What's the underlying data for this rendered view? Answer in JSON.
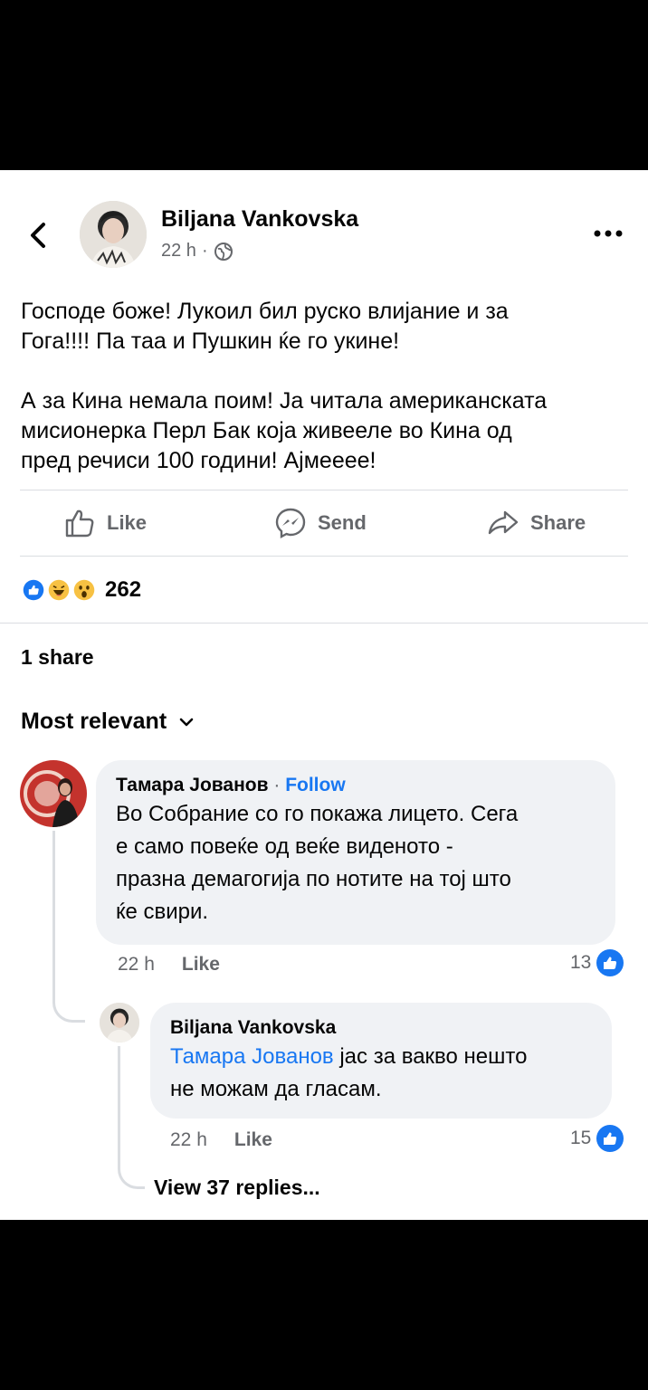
{
  "post": {
    "author": "Biljana Vankovska",
    "time": "22 h",
    "separator": "·",
    "paragraphs": [
      "Господе боже! Лукоил бил руско влијание и за\nГога!!!! Па таа и Пушкин ќе го укине!",
      "А за Кина немала поим! Ја читала американската\nмисионерка Перл Бак која живееле во Кина од\nпред речиси 100 години! Ајмееее!"
    ]
  },
  "actions": {
    "like": "Like",
    "send": "Send",
    "share": "Share"
  },
  "reactions": {
    "count": "262",
    "icons": [
      "like-reaction-icon",
      "haha-reaction-icon",
      "wow-reaction-icon"
    ]
  },
  "shares": "1 share",
  "sort_label": "Most relevant",
  "comments": [
    {
      "name": "Тамара Јованов",
      "follow": "Follow",
      "separator": " · ",
      "text": "Во Собрание со го покажа лицето. Сега\nе само повеќе од веќе виденото -\nпразна демагогија по нотите на тој што\nќе свири.",
      "time": "22 h",
      "like": "Like",
      "reactions": "13"
    }
  ],
  "reply": {
    "name": "Biljana Vankovska",
    "mention": "Тамара Јованов",
    "text_line1": " јас за вакво нешто",
    "text_line2": "не можам да гласам.",
    "time": "22 h",
    "like": "Like",
    "reactions": "15"
  },
  "view_replies": "View 37 replies...",
  "colors": {
    "accent": "#1877f2",
    "secondary_text": "#65676b",
    "bubble": "#f0f2f5"
  }
}
